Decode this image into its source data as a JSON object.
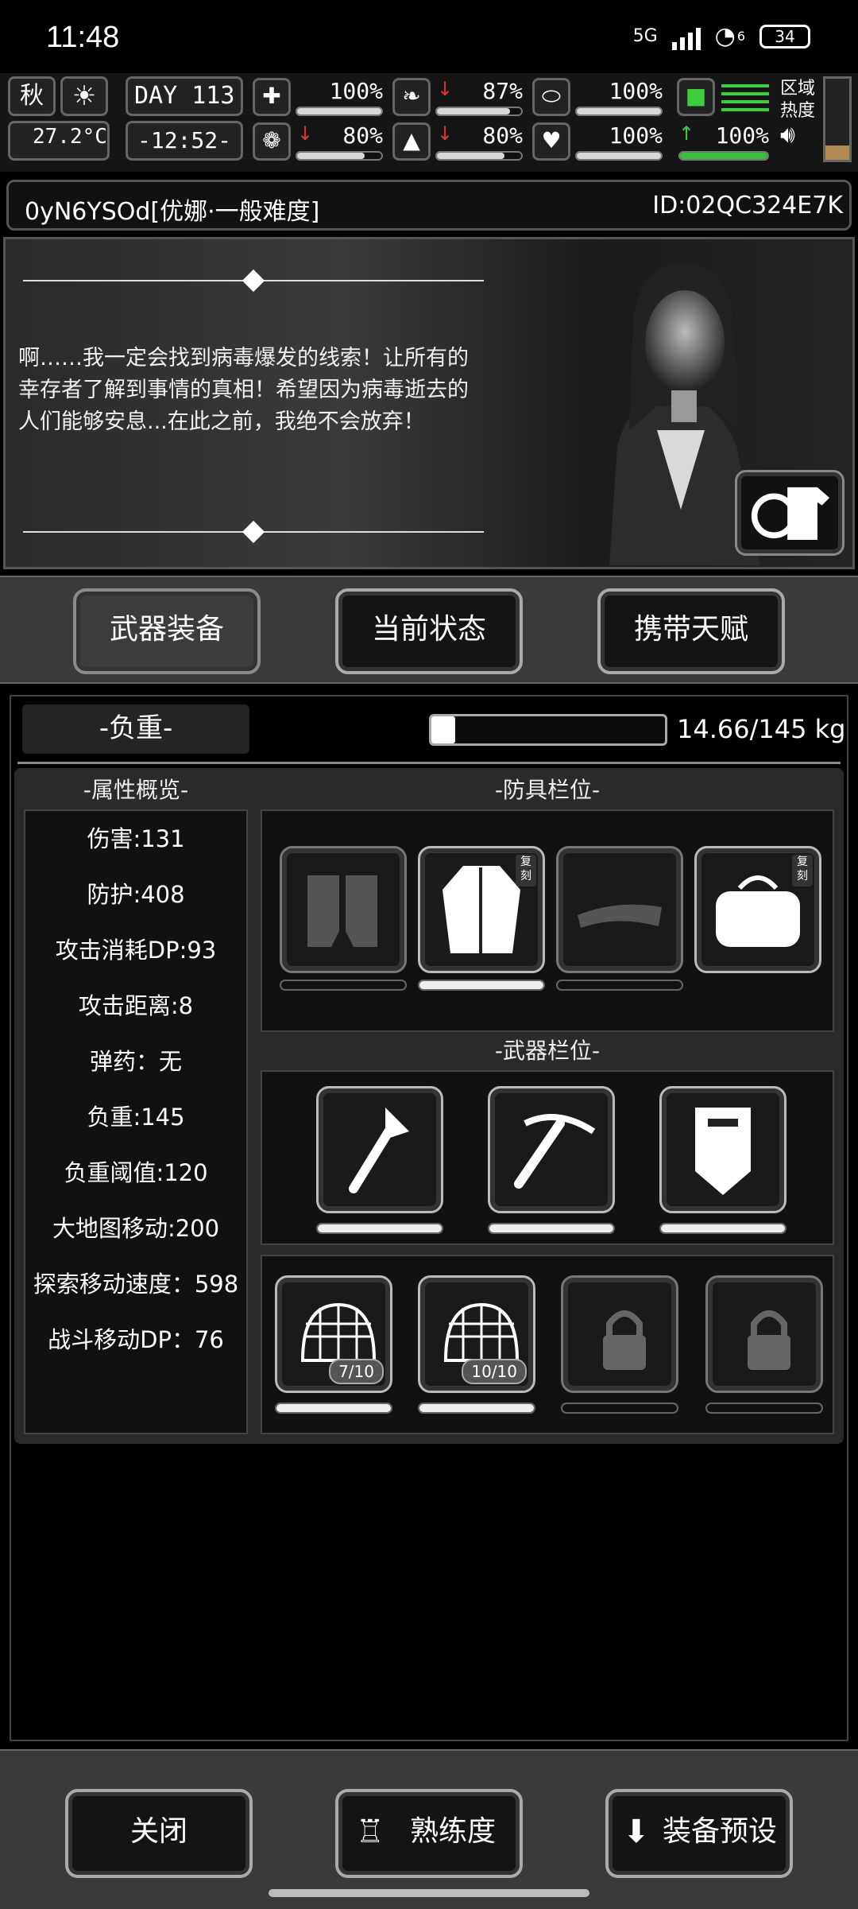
{
  "status_bar": {
    "time": "11:48",
    "network": "5G",
    "wifi_level": "6",
    "battery": "34"
  },
  "hud": {
    "season": "秋",
    "weather_icon": "sun-icon",
    "temperature": "27.2°C",
    "day_label": "DAY",
    "day_number": "113",
    "clock": "-12:52-",
    "stats": [
      {
        "icon": "medkit-icon",
        "value": "100%",
        "trend": "",
        "fill": 1.0
      },
      {
        "icon": "stomach-icon",
        "value": "87%",
        "trend": "down",
        "fill": 0.87
      },
      {
        "icon": "pill-icon",
        "value": "100%",
        "trend": "",
        "fill": 1.0
      },
      {
        "icon": "brain-icon",
        "value": "80%",
        "trend": "down",
        "fill": 0.8
      },
      {
        "icon": "water-drop-icon",
        "value": "80%",
        "trend": "down",
        "fill": 0.8
      },
      {
        "icon": "heart-icon",
        "value": "100%",
        "trend": "",
        "fill": 1.0
      },
      {
        "icon": "stamina-boot-icon",
        "value": "100%",
        "trend": "up",
        "fill": 1.0
      }
    ],
    "zone_heat_label": "区域热度",
    "zone_heat_fill": 0.18
  },
  "player": {
    "name": "0yN6YSOd[优娜·一般难度]",
    "id": "ID:02QC324E7K"
  },
  "dialogue": {
    "text": "啊……我一定会找到病毒爆发的线索！让所有的幸存者了解到事情的真相！希望因为病毒逝去的人们能够安息...在此之前，我绝不会放弃！"
  },
  "tabs": [
    {
      "label": "武器装备",
      "active": true
    },
    {
      "label": "当前状态",
      "active": false
    },
    {
      "label": "携带天赋",
      "active": false
    }
  ],
  "weight": {
    "label": "-负重-",
    "value": "14.66/145 kg",
    "fill": 0.101
  },
  "attributes": {
    "title": "-属性概览-",
    "rows": [
      "伤害:131",
      "防护:408",
      "攻击消耗DP:93",
      "攻击距离:8",
      "弹药：无",
      "负重:145",
      "负重阈值:120",
      "大地图移动:200",
      "探索移动速度：598",
      "战斗移动DP：76"
    ]
  },
  "armor": {
    "title": "-防具栏位-",
    "slots": [
      {
        "icon": "gloves-icon",
        "tag": "",
        "durability": 0
      },
      {
        "icon": "coat-icon",
        "tag": "复刻",
        "durability": 1.0
      },
      {
        "icon": "visor-cap-icon",
        "tag": "",
        "durability": 0
      },
      {
        "icon": "duffel-bag-icon",
        "tag": "复刻",
        "durability": 0
      }
    ]
  },
  "weapons": {
    "title": "-武器栏位-",
    "slots": [
      {
        "icon": "fire-axe-icon",
        "durability": 1.0
      },
      {
        "icon": "pickaxe-icon",
        "durability": 1.0
      },
      {
        "icon": "riot-shield-icon",
        "durability": 1.0
      }
    ]
  },
  "accessories": {
    "slots": [
      {
        "icon": "net-trap-icon",
        "count": "7/10",
        "durability": 1.0
      },
      {
        "icon": "net-trap-icon",
        "count": "10/10",
        "durability": 1.0
      },
      {
        "icon": "locked-slot-icon",
        "count": "",
        "durability": 0
      },
      {
        "icon": "locked-slot-icon",
        "count": "",
        "durability": 0
      }
    ]
  },
  "bottom_buttons": {
    "close": "关闭",
    "proficiency": "熟练度",
    "preset": "装备预设"
  },
  "colors": {
    "hp_down_arrow": "#e53030",
    "stamina_up": "#3ccf3c",
    "zone_heat": "#b38a50"
  }
}
